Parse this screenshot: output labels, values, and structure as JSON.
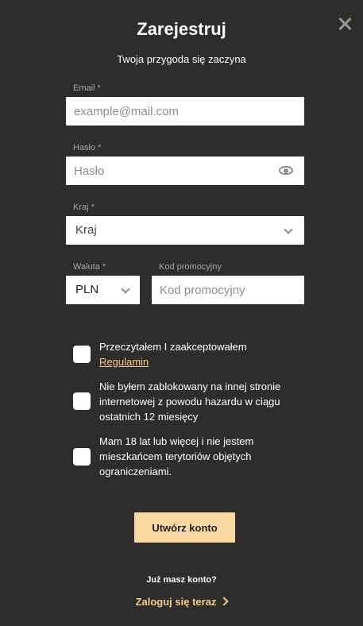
{
  "dialog": {
    "title": "Zarejestruj",
    "subtitle": "Twoja przygoda się zaczyna"
  },
  "form": {
    "email": {
      "label": "Email *",
      "placeholder": "example@mail.com",
      "value": ""
    },
    "password": {
      "label": "Hasło *",
      "placeholder": "Hasło",
      "value": ""
    },
    "country": {
      "label": "Kraj *",
      "selected": "Kraj"
    },
    "currency": {
      "label": "Waluta *",
      "selected": "PLN"
    },
    "promo": {
      "label": "Kod promocyjny",
      "placeholder": "Kod promocyjny",
      "value": ""
    }
  },
  "checkboxes": [
    {
      "text": "Przeczytałem I zaakceptowałem",
      "link": "Regulamin",
      "checked": false
    },
    {
      "text": "Nie byłem zablokowany na innej stronie internetowej z powodu hazardu w ciągu ostatnich 12 miesięcy",
      "checked": false
    },
    {
      "text": "Mam 18 lat lub więcej i nie jestem mieszkańcem terytoriów objętych ograniczeniami.",
      "checked": false
    }
  ],
  "actions": {
    "submit_label": "Utwórz konto",
    "have_account": "Już masz konto?",
    "login_link": "Zaloguj się teraz"
  },
  "icons": {
    "close": "close-icon",
    "eye": "eye-icon",
    "chevron": "chevron-down-icon",
    "arrow": "chevron-right-icon"
  },
  "colors": {
    "background": "#2f2d2b",
    "accent": "#fcd9a3",
    "link": "#f5cc8a",
    "label": "#a8a6a2"
  }
}
